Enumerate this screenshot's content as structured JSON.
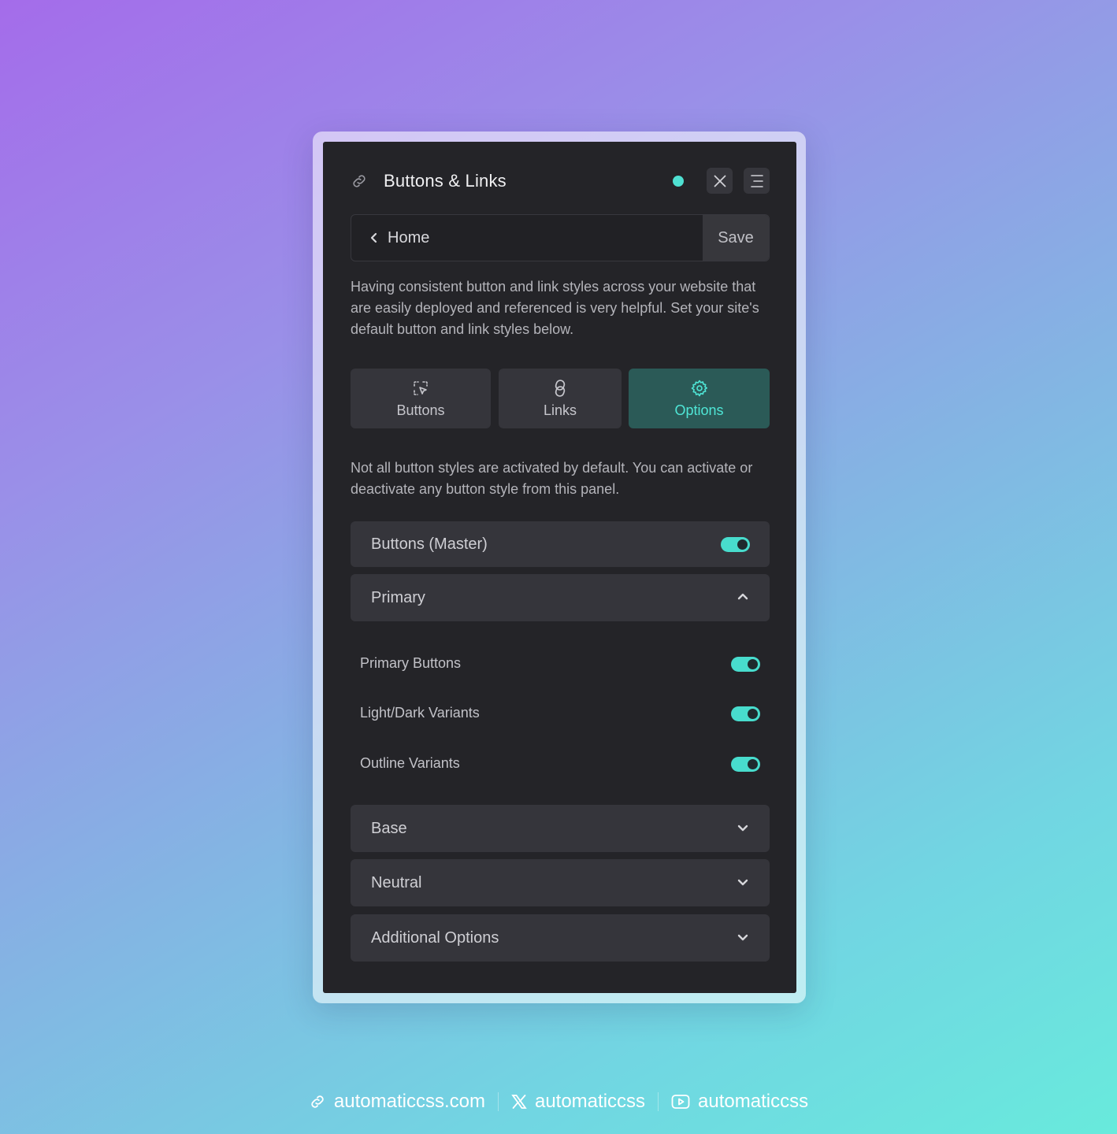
{
  "panel": {
    "title": "Buttons & Links",
    "status_color": "#4fe0d2",
    "accent_color": "#48dccd"
  },
  "nav": {
    "back_label": "Home",
    "save_label": "Save"
  },
  "intro_text": "Having consistent button and link styles across your website that are easily deployed and referenced is very helpful. Set your site's default button and link styles below.",
  "tabs": [
    {
      "label": "Buttons",
      "icon": "cursor-click-icon",
      "active": false
    },
    {
      "label": "Links",
      "icon": "chain-link-icon",
      "active": false
    },
    {
      "label": "Options",
      "icon": "gear-icon",
      "active": true
    }
  ],
  "options_text": "Not all button styles are activated by default. You can activate or deactivate any button style from this panel.",
  "master": {
    "label": "Buttons (Master)",
    "enabled": true
  },
  "sections": {
    "primary": {
      "label": "Primary",
      "expanded": true,
      "items": [
        {
          "label": "Primary Buttons",
          "enabled": true
        },
        {
          "label": "Light/Dark Variants",
          "enabled": true
        },
        {
          "label": "Outline Variants",
          "enabled": true
        }
      ]
    },
    "base": {
      "label": "Base",
      "expanded": false
    },
    "neutral": {
      "label": "Neutral",
      "expanded": false
    },
    "additional": {
      "label": "Additional Options",
      "expanded": false
    }
  },
  "footer": {
    "website": "automaticcss.com",
    "x_handle": "automaticcss",
    "youtube_handle": "automaticcss"
  }
}
